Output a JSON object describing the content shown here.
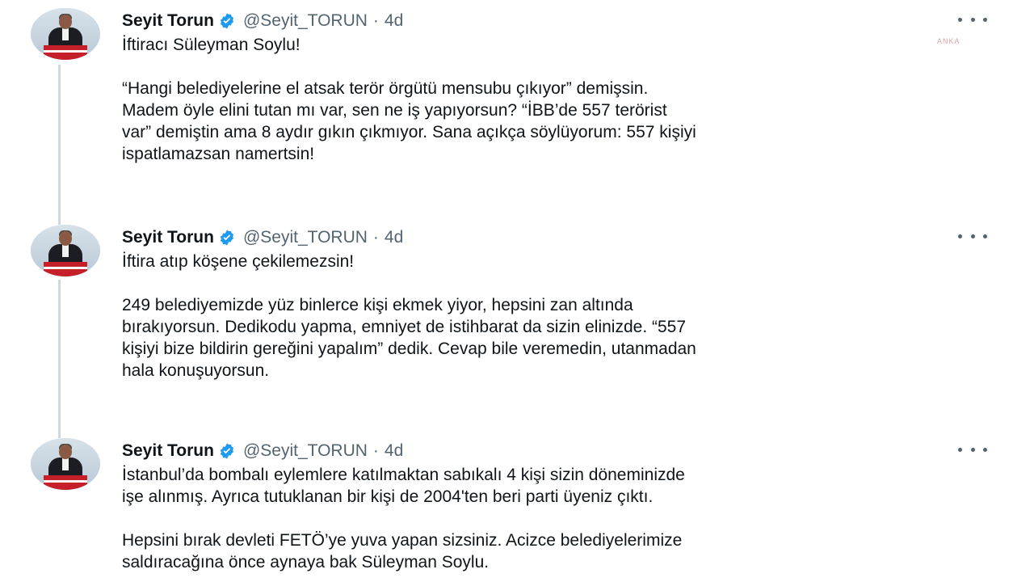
{
  "tweets": [
    {
      "name": "Seyit Torun",
      "handle": "@Seyit_TORUN",
      "separator": "·",
      "time": "4d",
      "paragraphs": [
        "İftiracı Süleyman Soylu!",
        "“Hangi belediyelerine el atsak terör örgütü mensubu çıkıyor” demişsin.\nMadem öyle elini tutan mı var, sen ne iş yapıyorsun? “İBB’de 557 terörist\nvar” demiştin ama 8 aydır gıkın çıkmıyor. Sana açıkça söylüyorum: 557 kişiyi\nispatlamazsan namertsin!"
      ]
    },
    {
      "name": "Seyit Torun",
      "handle": "@Seyit_TORUN",
      "separator": "·",
      "time": "4d",
      "paragraphs": [
        "İftira atıp köşene çekilemezsin!",
        "249 belediyemizde yüz binlerce kişi ekmek yiyor, hepsini zan altında\nbırakıyorsun. Dedikodu yapma, emniyet de istihbarat da sizin elinizde. “557\nkişiyi bize bildirin gereğini yapalım” dedik. Cevap bile veremedin, utanmadan\nhala konuşuyorsun."
      ]
    },
    {
      "name": "Seyit Torun",
      "handle": "@Seyit_TORUN",
      "separator": "·",
      "time": "4d",
      "paragraphs": [
        "İstanbul’da bombalı eylemlere katılmaktan sabıkalı 4 kişi sizin döneminizde\nişe alınmış. Ayrıca tutuklanan bir kişi de 2004'ten beri parti üyeniz çıktı.",
        "Hepsini bırak devleti FETÖ’ye yuva yapan sizsiniz. Acizce belediyelerimize\nsaldıracağına önce aynaya bak Süleyman Soylu."
      ]
    }
  ],
  "watermark": "ANKA",
  "icons": {
    "verified": "verified-badge-icon",
    "more": "more-options-icon",
    "avatar": "profile-avatar"
  },
  "colors": {
    "verified": "#1d9bf0",
    "text": "#0f1419",
    "secondary": "#536471",
    "thread": "#cfd9de"
  }
}
